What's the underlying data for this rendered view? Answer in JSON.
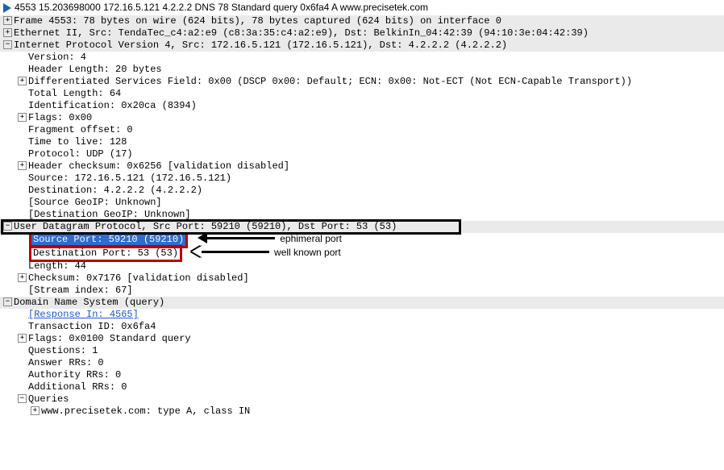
{
  "titlebar": "4553  15.203698000  172.16.5.121  4.2.2.2  DNS  78  Standard query 0x6fa4  A  www.precisetek.com",
  "frame": {
    "summary": "Frame 4553: 78 bytes on wire (624 bits), 78 bytes captured (624 bits) on interface 0"
  },
  "eth": {
    "summary": "Ethernet II, Src: TendaTec_c4:a2:e9 (c8:3a:35:c4:a2:e9), Dst: BelkinIn_04:42:39 (94:10:3e:04:42:39)"
  },
  "ip": {
    "summary": "Internet Protocol Version 4, Src: 172.16.5.121 (172.16.5.121), Dst: 4.2.2.2 (4.2.2.2)",
    "version": "Version: 4",
    "hdr_len": "Header Length: 20 bytes",
    "dsfield": "Differentiated Services Field: 0x00 (DSCP 0x00: Default; ECN: 0x00: Not-ECT (Not ECN-Capable Transport))",
    "total_len": "Total Length: 64",
    "identification": "Identification: 0x20ca (8394)",
    "flags": "Flags: 0x00",
    "frag_offset": "Fragment offset: 0",
    "ttl": "Time to live: 128",
    "protocol": "Protocol: UDP (17)",
    "checksum": "Header checksum: 0x6256 [validation disabled]",
    "src": "Source: 172.16.5.121 (172.16.5.121)",
    "dst": "Destination: 4.2.2.2 (4.2.2.2)",
    "src_geoip": "[Source GeoIP: Unknown]",
    "dst_geoip": "[Destination GeoIP: Unknown]"
  },
  "udp": {
    "summary": "User Datagram Protocol, Src Port: 59210 (59210), Dst Port: 53 (53)",
    "srcport": "Source Port: 59210 (59210)",
    "dstport": "Destination Port: 53 (53)",
    "length": "Length: 44",
    "checksum": "Checksum: 0x7176 [validation disabled]",
    "stream_idx": "[Stream index: 67]"
  },
  "dns": {
    "summary": "Domain Name System (query)",
    "response_in": "[Response In: 4565]",
    "txid": "Transaction ID: 0x6fa4",
    "flags": "Flags: 0x0100 Standard query",
    "questions": "Questions: 1",
    "answer_rrs": "Answer RRs: 0",
    "authority_rrs": "Authority RRs: 0",
    "additional_rrs": "Additional RRs: 0",
    "queries_label": "Queries",
    "query_item": "www.precisetek.com: type A, class IN"
  },
  "annotations": {
    "ephemeral": "ephimeral port",
    "wellknown": "well known port"
  },
  "toggles": {
    "plus": "+",
    "minus": "−"
  }
}
